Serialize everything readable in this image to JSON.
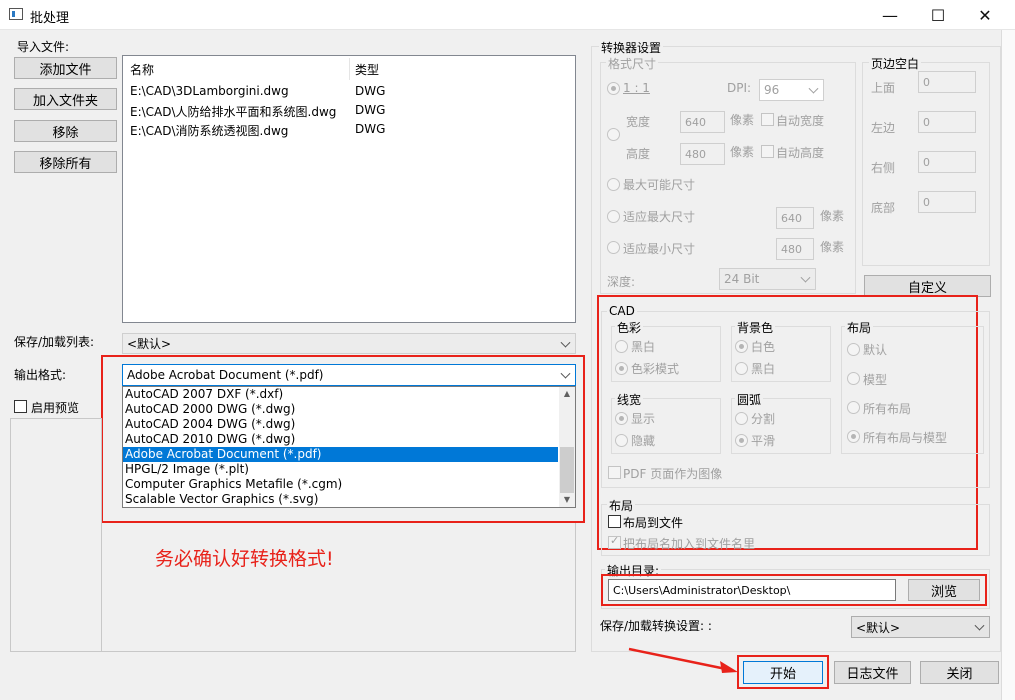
{
  "window": {
    "title": "批处理",
    "min": "—",
    "max": "☐",
    "close": "✕"
  },
  "import": {
    "label": "导入文件:",
    "buttons": [
      "添加文件",
      "加入文件夹",
      "移除",
      "移除所有"
    ],
    "columns": [
      "名称",
      "类型"
    ],
    "files": [
      {
        "name": "E:\\CAD\\3DLamborgini.dwg",
        "type": "DWG"
      },
      {
        "name": "E:\\CAD\\人防给排水平面和系统图.dwg",
        "type": "DWG"
      },
      {
        "name": "E:\\CAD\\消防系统透视图.dwg",
        "type": "DWG"
      }
    ]
  },
  "saveload_list": {
    "label": "保存/加载列表:",
    "value": "<默认>"
  },
  "output_format": {
    "label": "输出格式:",
    "value": "Adobe Acrobat Document (*.pdf)",
    "options": [
      "AutoCAD 2007 DXF (*.dxf)",
      "AutoCAD 2000 DWG (*.dwg)",
      "AutoCAD 2004 DWG (*.dwg)",
      "AutoCAD 2010 DWG (*.dwg)",
      "Adobe Acrobat Document (*.pdf)",
      "HPGL/2 Image (*.plt)",
      "Computer Graphics Metafile (*.cgm)",
      "Scalable Vector Graphics (*.svg)"
    ],
    "selected_index": 4
  },
  "enable_preview": "启用预览",
  "annotation": "务必确认好转换格式!",
  "converter": {
    "title": "转换器设置",
    "format_size": {
      "title": "格式尺寸",
      "ratio": "1 : 1",
      "dpi_label": "DPI:",
      "dpi_value": "96",
      "width_label": "宽度",
      "width_value": "640",
      "height_label": "高度",
      "height_value": "480",
      "pixel": "像素",
      "auto_width": "自动宽度",
      "auto_height": "自动高度",
      "max_possible": "最大可能尺寸",
      "fit_max": "适应最大尺寸",
      "fit_max_value": "640",
      "fit_min": "适应最小尺寸",
      "fit_min_value": "480",
      "depth_label": "深度:",
      "depth_value": "24 Bit"
    },
    "margins": {
      "title": "页边空白",
      "top": "上面",
      "left": "左边",
      "right": "右侧",
      "bottom": "底部",
      "value": "0"
    },
    "custom_button": "自定义",
    "cad": {
      "title": "CAD",
      "color": {
        "title": "色彩",
        "opt1": "黑白",
        "opt2": "色彩模式"
      },
      "background": {
        "title": "背景色",
        "opt1": "白色",
        "opt2": "黑白"
      },
      "layout": {
        "title": "布局",
        "opt1": "默认",
        "opt2": "模型",
        "opt3": "所有布局",
        "opt4": "所有布局与模型"
      },
      "linewidth": {
        "title": "线宽",
        "opt1": "显示",
        "opt2": "隐藏"
      },
      "arc": {
        "title": "圆弧",
        "opt1": "分割",
        "opt2": "平滑"
      },
      "pdf_as_image": "PDF 页面作为图像"
    },
    "layout_section": {
      "title": "布局",
      "layout_to_file": "布局到文件",
      "add_layout_name": "把布局名加入到文件名里"
    },
    "output_dir": {
      "label": "输出目录:",
      "value": "C:\\Users\\Administrator\\Desktop\\",
      "browse": "浏览"
    },
    "saveload_settings": {
      "label": "保存/加载转换设置: :",
      "value": "<默认>"
    }
  },
  "bottom": {
    "start": "开始",
    "log": "日志文件",
    "close": "关闭"
  },
  "colors": {
    "accent": "#0078d7",
    "annotation_red": "#e8221a"
  }
}
